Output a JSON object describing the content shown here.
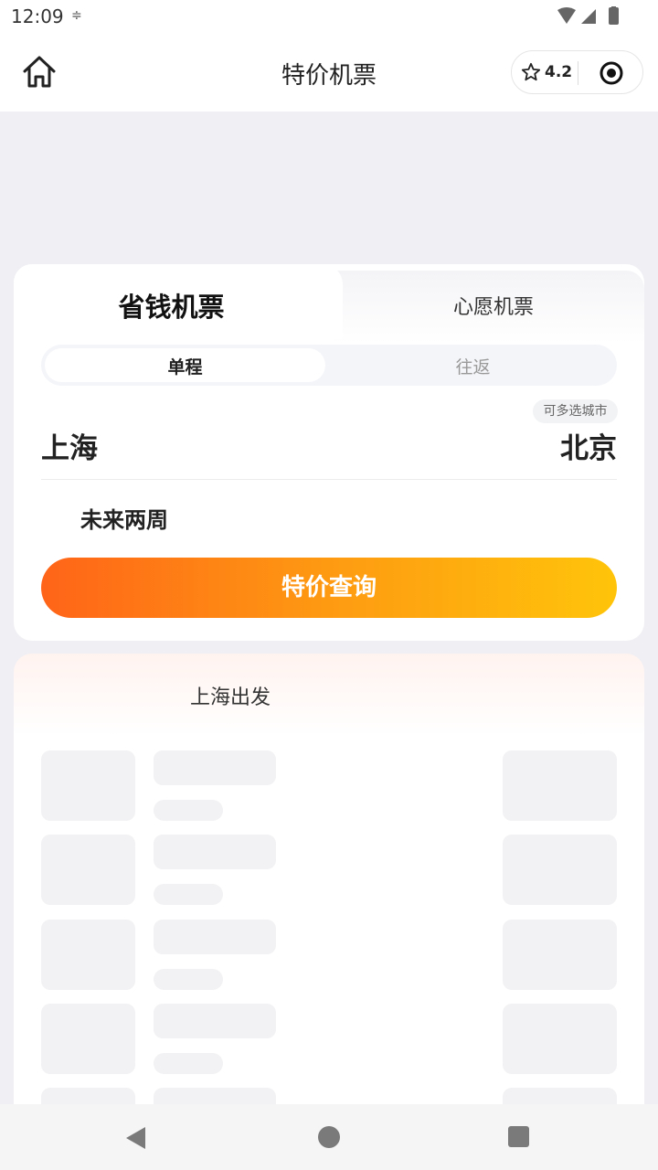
{
  "status_bar": {
    "time": "12:09",
    "extra_icon": "≑"
  },
  "header": {
    "title": "特价机票",
    "rating": "4.2",
    "icons": [
      "home-icon",
      "star-icon",
      "target-icon"
    ]
  },
  "search_card": {
    "tabs": [
      "省钱机票",
      "心愿机票"
    ],
    "trip_types": [
      "单程",
      "往返"
    ],
    "multi_city_badge": "可多选城市",
    "from_city": "上海",
    "to_city": "北京",
    "date_range": "未来两周",
    "search_button": "特价查询",
    "button_gradient": [
      "#ff6418",
      "#fe9a12",
      "#ffc40a"
    ]
  },
  "list_card": {
    "title": "上海出发",
    "loading_rows": 5
  },
  "nav_bar": {
    "icons": [
      "back-icon",
      "home-circle-icon",
      "recent-apps-icon"
    ]
  }
}
